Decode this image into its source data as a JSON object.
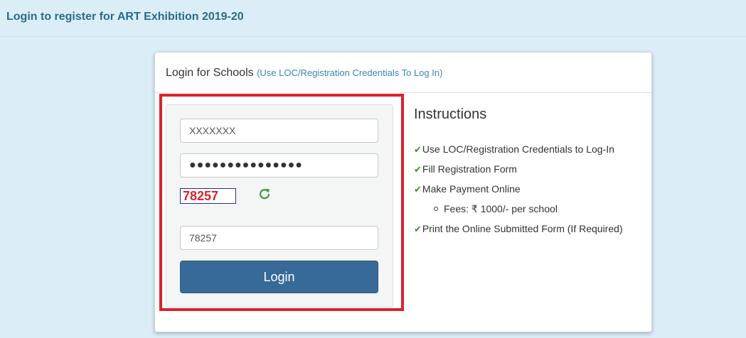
{
  "header": {
    "title": "Login to register for ART Exhibition 2019-20"
  },
  "panel": {
    "title": "Login for Schools",
    "subtitle": "(Use LOC/Registration Credentials To Log In)"
  },
  "form": {
    "username_value": "XXXXXXX",
    "password_value": "●●●●●●●●●●●●●●●",
    "captcha_code": "78257",
    "captcha_input_value": "78257",
    "login_label": "Login"
  },
  "instructions": {
    "heading": "Instructions",
    "check_glyph": "✔",
    "items": [
      "Use LOC/Registration Credentials to Log-In",
      "Fill Registration Form",
      "Make Payment Online",
      "Fees: ₹ 1000/- per school",
      "Print  the Online Submitted Form (If Required)"
    ]
  },
  "colors": {
    "page_bg": "#dbeef7",
    "header_text": "#2a6a8a",
    "highlight_border": "#d9232d",
    "button_bg": "#376a98",
    "captcha_text": "#d9232d",
    "check_color": "#3c8a3c"
  }
}
